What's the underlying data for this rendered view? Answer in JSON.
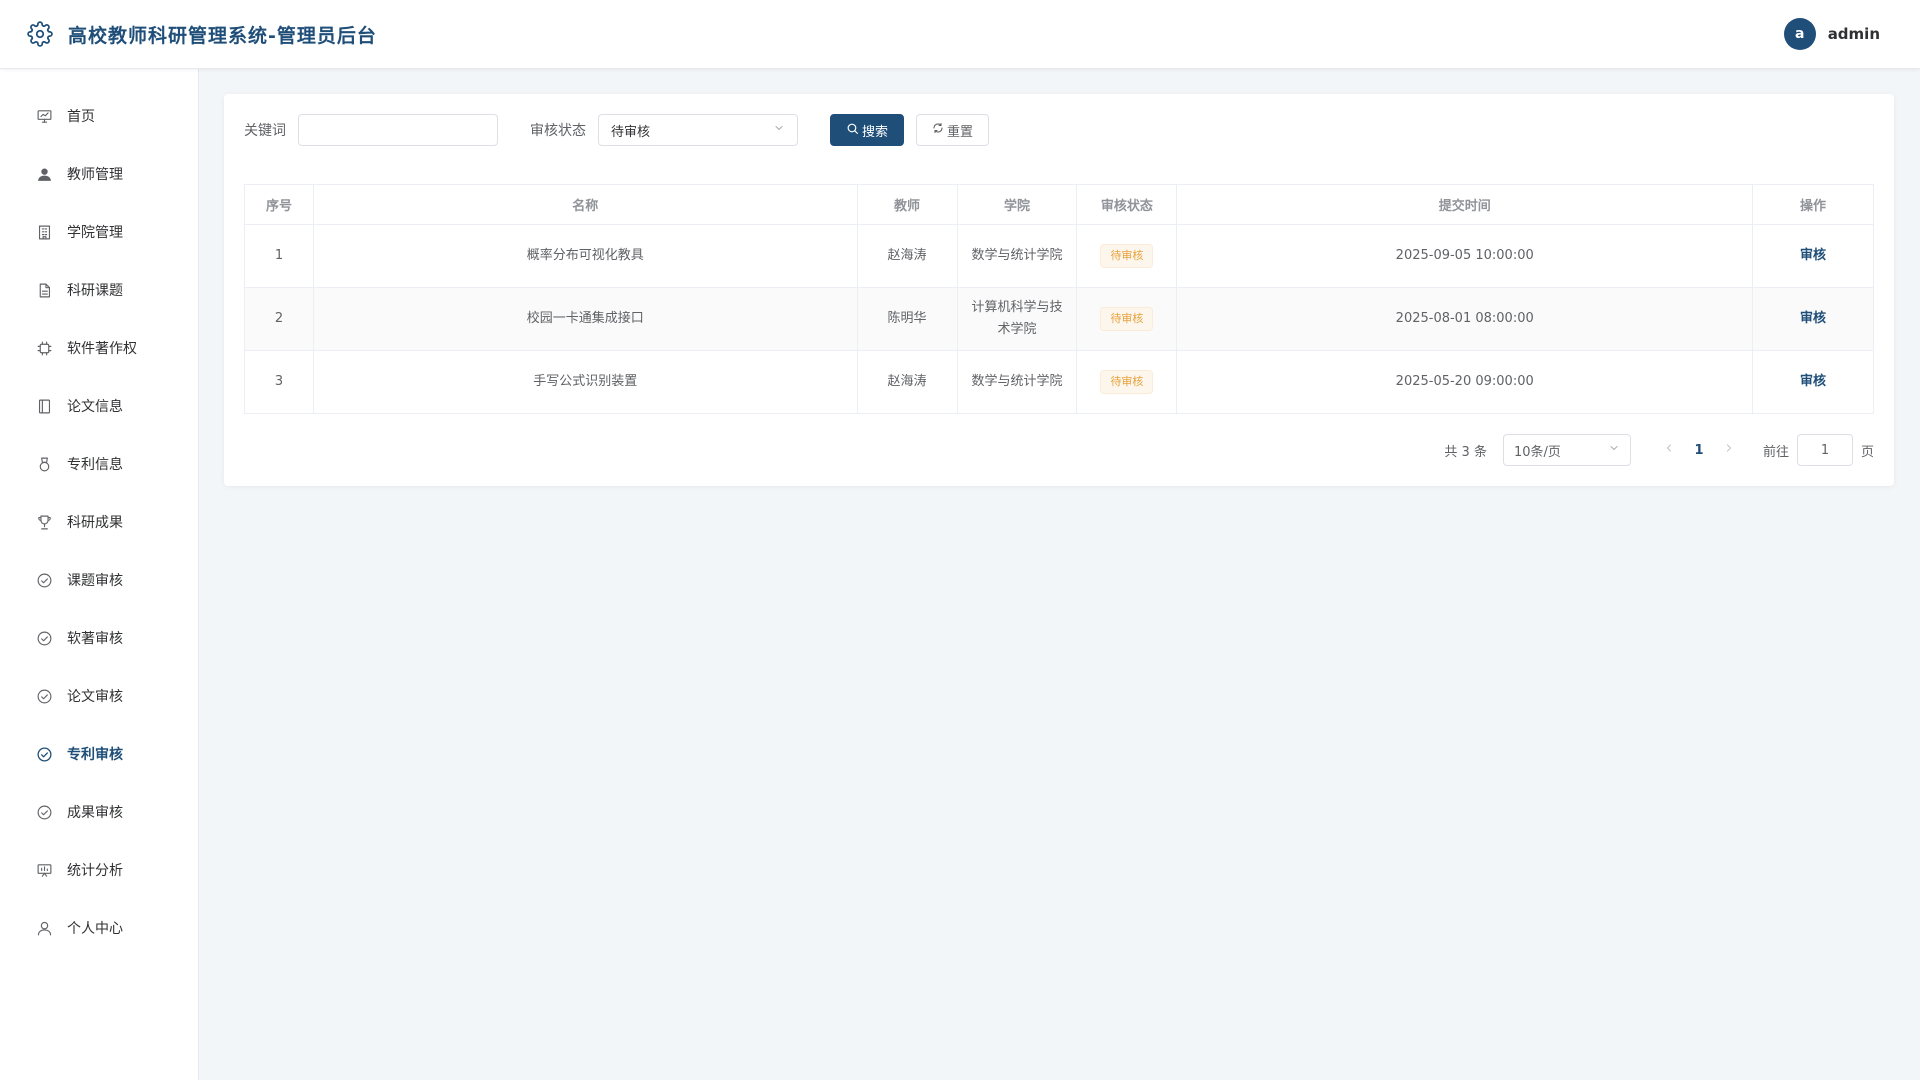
{
  "app": {
    "title": "高校教师科研管理系统-管理员后台",
    "brand_icon": "gear-icon"
  },
  "user": {
    "avatar_letter": "a",
    "name": "admin"
  },
  "sidebar": {
    "items": [
      {
        "label": "首页",
        "icon": "presentation-icon",
        "active": false
      },
      {
        "label": "教师管理",
        "icon": "user-filled-icon",
        "active": false
      },
      {
        "label": "学院管理",
        "icon": "office-building-icon",
        "active": false
      },
      {
        "label": "科研课题",
        "icon": "document-icon",
        "active": false
      },
      {
        "label": "软件著作权",
        "icon": "cpu-icon",
        "active": false
      },
      {
        "label": "论文信息",
        "icon": "notebook-icon",
        "active": false
      },
      {
        "label": "专利信息",
        "icon": "medal-icon",
        "active": false
      },
      {
        "label": "科研成果",
        "icon": "trophy-icon",
        "active": false
      },
      {
        "label": "课题审核",
        "icon": "circle-check-icon",
        "active": false
      },
      {
        "label": "软著审核",
        "icon": "circle-check-icon",
        "active": false
      },
      {
        "label": "论文审核",
        "icon": "circle-check-icon",
        "active": false
      },
      {
        "label": "专利审核",
        "icon": "circle-check-icon",
        "active": true
      },
      {
        "label": "成果审核",
        "icon": "circle-check-icon",
        "active": false
      },
      {
        "label": "统计分析",
        "icon": "data-board-icon",
        "active": false
      },
      {
        "label": "个人中心",
        "icon": "user-icon",
        "active": false
      }
    ]
  },
  "filters": {
    "keyword_label": "关键词",
    "keyword_value": "",
    "keyword_placeholder": "",
    "status_label": "审核状态",
    "status_value": "待审核",
    "search_label": "搜索",
    "reset_label": "重置"
  },
  "table": {
    "columns": [
      "序号",
      "名称",
      "教师",
      "学院",
      "审核状态",
      "提交时间",
      "操作"
    ],
    "rows": [
      {
        "index": "1",
        "name": "概率分布可视化教具",
        "teacher": "赵海涛",
        "college": "数学与统计学院",
        "status": "待审核",
        "submitted": "2025-09-05 10:00:00",
        "action": "审核"
      },
      {
        "index": "2",
        "name": "校园一卡通集成接口",
        "teacher": "陈明华",
        "college": "计算机科学与技术学院",
        "status": "待审核",
        "submitted": "2025-08-01 08:00:00",
        "action": "审核"
      },
      {
        "index": "3",
        "name": "手写公式识别装置",
        "teacher": "赵海涛",
        "college": "数学与统计学院",
        "status": "待审核",
        "submitted": "2025-05-20 09:00:00",
        "action": "审核"
      }
    ]
  },
  "pagination": {
    "total_text": "共 3 条",
    "page_size": "10条/页",
    "current_page": "1",
    "goto_label": "前往",
    "goto_value": "1",
    "page_suffix": "页"
  },
  "colors": {
    "primary": "#1f4e79",
    "warning": "#e6a23c",
    "background": "#f3f6f9"
  }
}
